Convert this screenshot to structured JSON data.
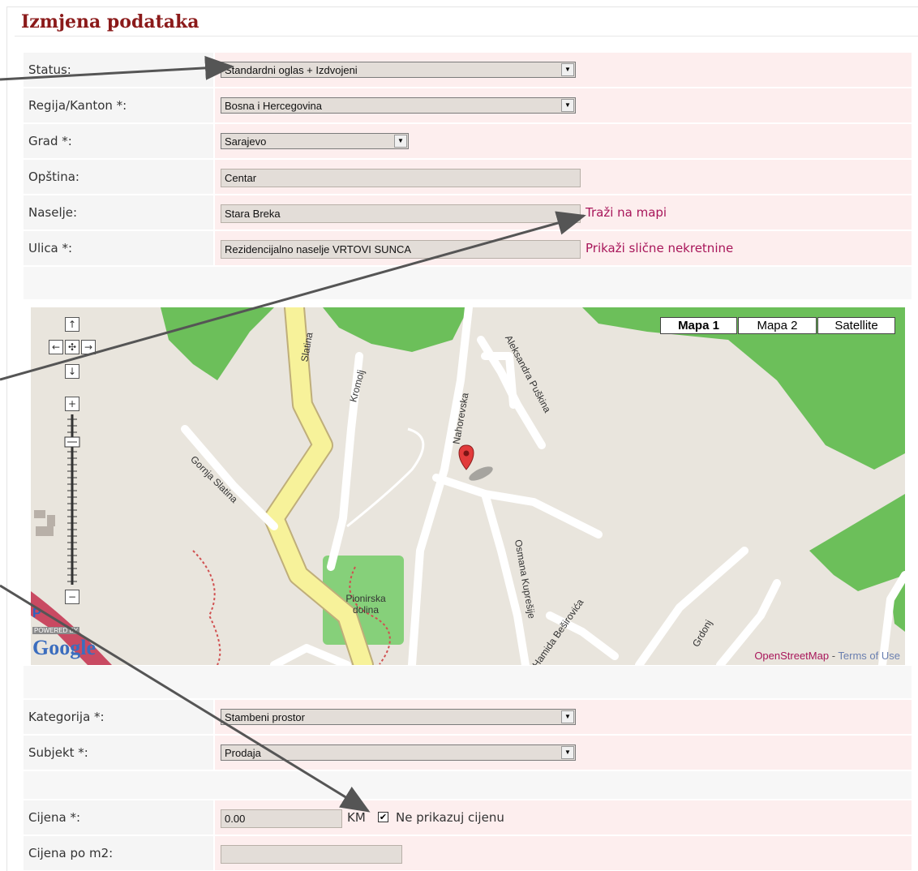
{
  "page": {
    "title": "Izmjena podataka"
  },
  "fields": {
    "status": {
      "label": "Status:",
      "value": "Standardni oglas + Izdvojeni"
    },
    "regija": {
      "label": "Regija/Kanton *:",
      "value": "Bosna i Hercegovina"
    },
    "grad": {
      "label": "Grad *:",
      "value": "Sarajevo"
    },
    "opstina": {
      "label": "Opština:",
      "value": "Centar"
    },
    "naselje": {
      "label": "Naselje:",
      "value": "Stara Breka",
      "link": "Traži na mapi"
    },
    "ulica": {
      "label": "Ulica *:",
      "value": "Rezidencijalno naselje VRTOVI SUNCA",
      "link": "Prikaži slične nekretnine"
    },
    "kategorija": {
      "label": "Kategorija *:",
      "value": "Stambeni prostor"
    },
    "subjekt": {
      "label": "Subjekt *:",
      "value": "Prodaja"
    },
    "cijena": {
      "label": "Cijena *:",
      "value": "0.00",
      "unit": "KM",
      "checkbox_label": "Ne prikazuj cijenu",
      "checkbox_checked": true
    },
    "cijena_m2": {
      "label": "Cijena po m2:",
      "value": ""
    }
  },
  "map": {
    "type_buttons": [
      "Mapa 1",
      "Mapa 2",
      "Satellite"
    ],
    "active_type": "Mapa 1",
    "streets": [
      "Slatina",
      "Kromolj",
      "Nahorevska",
      "Aleksandra Puškina",
      "Gornja Slatina",
      "Osmana Kuprešije",
      "Hamida Beširovića",
      "Pionirska dolina",
      "Grdonj"
    ],
    "attribution": {
      "source": "OpenStreetMap",
      "separator": " - ",
      "terms": "Terms of Use"
    },
    "branding": {
      "p": "P",
      "powered": "POWERED BY",
      "google": "Google"
    },
    "pan_icons": [
      "arrow-up-icon",
      "arrow-left-icon",
      "pan-center-icon",
      "arrow-right-icon",
      "arrow-down-icon"
    ],
    "zoom_in_icon": "plus-icon",
    "zoom_out_icon": "minus-icon",
    "marker_icon": "map-pin-icon"
  },
  "colors": {
    "title": "#8b1a1a",
    "link": "#a8165a",
    "row_value_bg": "#fdeeee",
    "row_label_bg": "#f5f5f5",
    "map_land": "#e9e5dd",
    "map_forest": "#6cbf5a",
    "map_major_road": "#f7f29a",
    "marker": "#e23b3b",
    "annotation_arrow": "#555555"
  }
}
